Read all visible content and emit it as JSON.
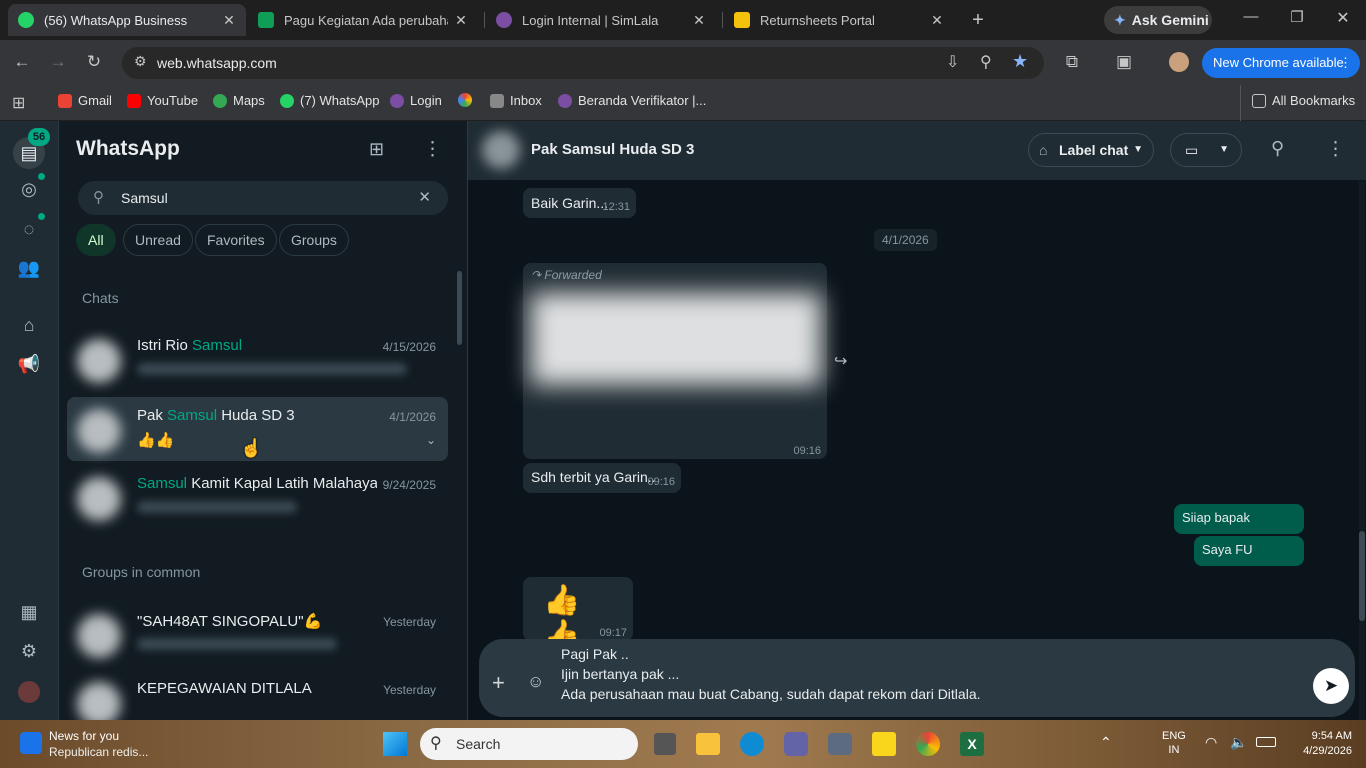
{
  "browser": {
    "tabs": [
      {
        "title": "(56) WhatsApp Business",
        "active": true,
        "color": "#25d366"
      },
      {
        "title": "Pagu Kegiatan Ada perubahan d",
        "active": false,
        "color": "#0f9d58"
      },
      {
        "title": "Login Internal | SimLala",
        "active": false,
        "color": "#7b4ea3"
      },
      {
        "title": "Returnsheets Portal",
        "active": false,
        "color": "#f4c20d"
      }
    ],
    "new_tab": "+",
    "ask_gemini": "Ask Gemini",
    "url": "web.whatsapp.com",
    "new_chrome": "New Chrome available",
    "bookmarks": [
      "Gmail",
      "YouTube",
      "Maps",
      "(7) WhatsApp",
      "Login",
      "Inbox",
      "Beranda Verifikator |..."
    ],
    "all_bookmarks": "All Bookmarks"
  },
  "rail": {
    "badge": "56"
  },
  "sidebar": {
    "title": "WhatsApp",
    "search_value": "Samsul",
    "filters": [
      "All",
      "Unread",
      "Favorites",
      "Groups"
    ],
    "chats_header": "Chats",
    "chats": [
      {
        "pre": "Istri Rio ",
        "hl": "Samsul",
        "post": "",
        "date": "4/15/2026",
        "preview": ""
      },
      {
        "pre": "Pak ",
        "hl": "Samsul",
        "post": " Huda SD 3",
        "date": "4/1/2026",
        "preview": "👍👍"
      },
      {
        "pre": "",
        "hl": "Samsul",
        "post": " Kamit Kapal Latih Malahaya...",
        "date": "9/24/2025",
        "preview": ""
      }
    ],
    "groups_header": "Groups in common",
    "groups": [
      {
        "name": "\"SAH48AT SINGOPALU\"💪",
        "date": "Yesterday"
      },
      {
        "name": "KEPEGAWAIAN DITLALA",
        "date": "Yesterday"
      }
    ]
  },
  "chat": {
    "name": "Pak Samsul Huda SD 3",
    "label_chat": "Label chat",
    "messages": [
      {
        "text": "Baik Garin...",
        "time": "12:31"
      },
      {
        "date": "4/1/2026"
      },
      {
        "forwarded": "Forwarded",
        "time": "09:16"
      },
      {
        "text": "Sdh terbit ya Garin..",
        "time": "09:16"
      },
      {
        "out": "Siiap bapak"
      },
      {
        "out": "Saya FU"
      },
      {
        "text": "👍👍",
        "time": "09:17"
      }
    ],
    "composer_lines": [
      "Pagi Pak ..",
      "Ijin bertanya pak ...",
      "Ada perusahaan mau buat Cabang, sudah dapat rekom dari Ditlala."
    ]
  },
  "taskbar": {
    "news_title": "News for you",
    "news_sub": "Republican redis...",
    "search": "Search",
    "lang1": "ENG",
    "lang2": "IN",
    "time": "9:54 AM",
    "date": "4/29/2026"
  }
}
